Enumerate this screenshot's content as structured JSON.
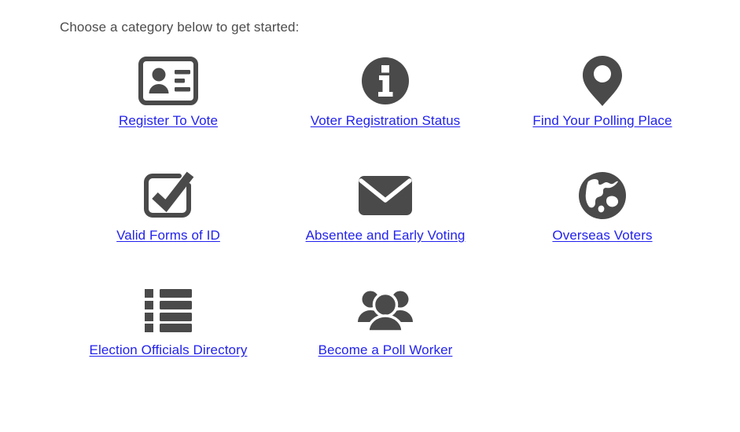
{
  "page": {
    "intro_text": "Choose a category below to get started:",
    "background_color": "#ffffff",
    "icon_color": "#4a4a4a",
    "link_color": "#2222ee",
    "intro_text_color": "#4c4c4c"
  },
  "categories": [
    {
      "label": "Register To Vote",
      "icon": "id-card-icon"
    },
    {
      "label": "Voter Registration Status",
      "icon": "info-circle-icon"
    },
    {
      "label": "Find Your Polling Place",
      "icon": "map-pin-icon"
    },
    {
      "label": "Valid Forms of ID",
      "icon": "checkbox-check-icon"
    },
    {
      "label": "Absentee and Early Voting",
      "icon": "envelope-icon"
    },
    {
      "label": "Overseas Voters",
      "icon": "globe-icon"
    },
    {
      "label": "Election Officials Directory",
      "icon": "list-icon"
    },
    {
      "label": "Become a Poll Worker",
      "icon": "people-group-icon"
    }
  ]
}
